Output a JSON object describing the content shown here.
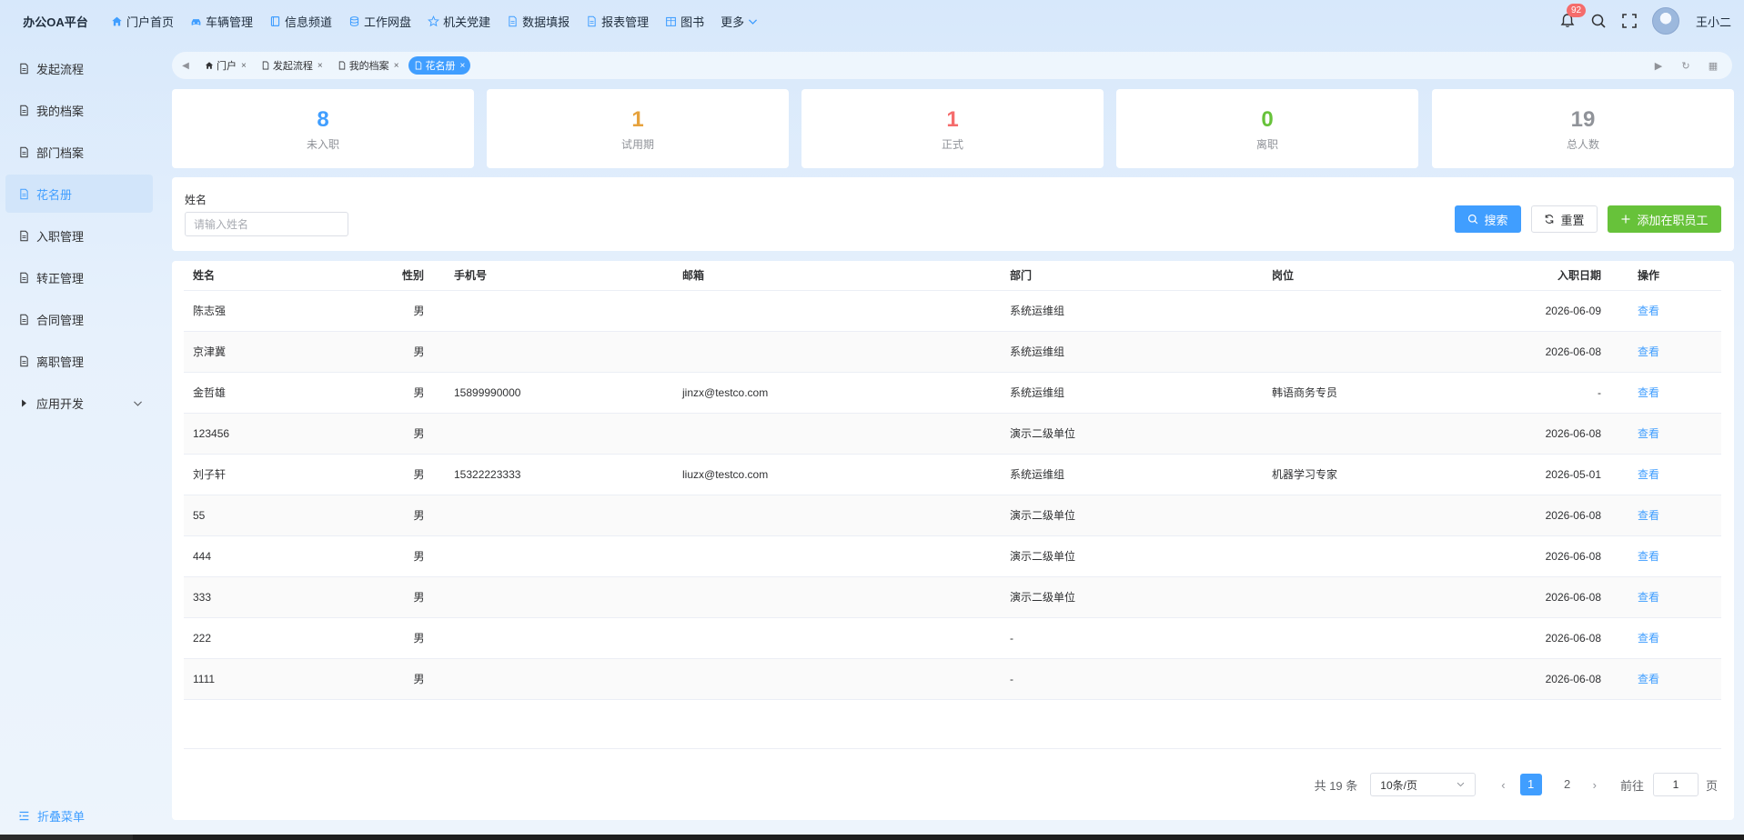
{
  "app": {
    "title": "办公OA平台"
  },
  "topnav": [
    {
      "label": "门户首页",
      "icon": "home-icon"
    },
    {
      "label": "车辆管理",
      "icon": "car-icon"
    },
    {
      "label": "信息频道",
      "icon": "book-icon"
    },
    {
      "label": "工作网盘",
      "icon": "database-icon"
    },
    {
      "label": "机关党建",
      "icon": "star-icon"
    },
    {
      "label": "数据填报",
      "icon": "document-icon"
    },
    {
      "label": "报表管理",
      "icon": "document-icon"
    },
    {
      "label": "图书",
      "icon": "grid-box-icon"
    },
    {
      "label": "更多",
      "icon": "chevron-down-icon"
    }
  ],
  "header": {
    "notification_count": "92",
    "username": "王小二"
  },
  "sidebar": {
    "items": [
      {
        "label": "发起流程"
      },
      {
        "label": "我的档案"
      },
      {
        "label": "部门档案"
      },
      {
        "label": "花名册"
      },
      {
        "label": "入职管理"
      },
      {
        "label": "转正管理"
      },
      {
        "label": "合同管理"
      },
      {
        "label": "离职管理"
      },
      {
        "label": "应用开发"
      }
    ],
    "collapse_label": "折叠菜单"
  },
  "tabs": [
    {
      "label": "门户"
    },
    {
      "label": "发起流程"
    },
    {
      "label": "我的档案"
    },
    {
      "label": "花名册"
    }
  ],
  "stats": [
    {
      "value": "8",
      "label": "未入职",
      "color": "#409eff"
    },
    {
      "value": "1",
      "label": "试用期",
      "color": "#e6a23c"
    },
    {
      "value": "1",
      "label": "正式",
      "color": "#f56c6c"
    },
    {
      "value": "0",
      "label": "离职",
      "color": "#67c23a"
    },
    {
      "value": "19",
      "label": "总人数",
      "color": "#909399"
    }
  ],
  "search": {
    "field_label": "姓名",
    "placeholder": "请输入姓名",
    "search_label": "搜索",
    "reset_label": "重置",
    "add_label": "添加在职员工"
  },
  "table": {
    "columns": [
      "姓名",
      "性别",
      "手机号",
      "邮箱",
      "部门",
      "岗位",
      "入职日期",
      "操作"
    ],
    "action_label": "查看",
    "rows": [
      {
        "name": "陈志强",
        "gender": "男",
        "phone": "",
        "email": "",
        "dept": "系统运维组",
        "post": "",
        "date": "2026-06-09"
      },
      {
        "name": "京津冀",
        "gender": "男",
        "phone": "",
        "email": "",
        "dept": "系统运维组",
        "post": "",
        "date": "2026-06-08"
      },
      {
        "name": "金哲雄",
        "gender": "男",
        "phone": "15899990000",
        "email": "jinzx@testco.com",
        "dept": "系统运维组",
        "post": "韩语商务专员",
        "date": "-"
      },
      {
        "name": "123456",
        "gender": "男",
        "phone": "",
        "email": "",
        "dept": "演示二级单位",
        "post": "",
        "date": "2026-06-08"
      },
      {
        "name": "刘子轩",
        "gender": "男",
        "phone": "15322223333",
        "email": "liuzx@testco.com",
        "dept": "系统运维组",
        "post": "机器学习专家",
        "date": "2026-05-01"
      },
      {
        "name": "55",
        "gender": "男",
        "phone": "",
        "email": "",
        "dept": "演示二级单位",
        "post": "",
        "date": "2026-06-08"
      },
      {
        "name": "444",
        "gender": "男",
        "phone": "",
        "email": "",
        "dept": "演示二级单位",
        "post": "",
        "date": "2026-06-08"
      },
      {
        "name": "333",
        "gender": "男",
        "phone": "",
        "email": "",
        "dept": "演示二级单位",
        "post": "",
        "date": "2026-06-08"
      },
      {
        "name": "222",
        "gender": "男",
        "phone": "",
        "email": "",
        "dept": "-",
        "post": "",
        "date": "2026-06-08"
      },
      {
        "name": "1111",
        "gender": "男",
        "phone": "",
        "email": "",
        "dept": "-",
        "post": "",
        "date": "2026-06-08"
      }
    ]
  },
  "pagination": {
    "total_text": "共 19 条",
    "page_size": "10条/页",
    "pages": [
      "1",
      "2"
    ],
    "current": "1",
    "goto_label": "前往",
    "goto_value": "1",
    "page_suffix": "页"
  }
}
